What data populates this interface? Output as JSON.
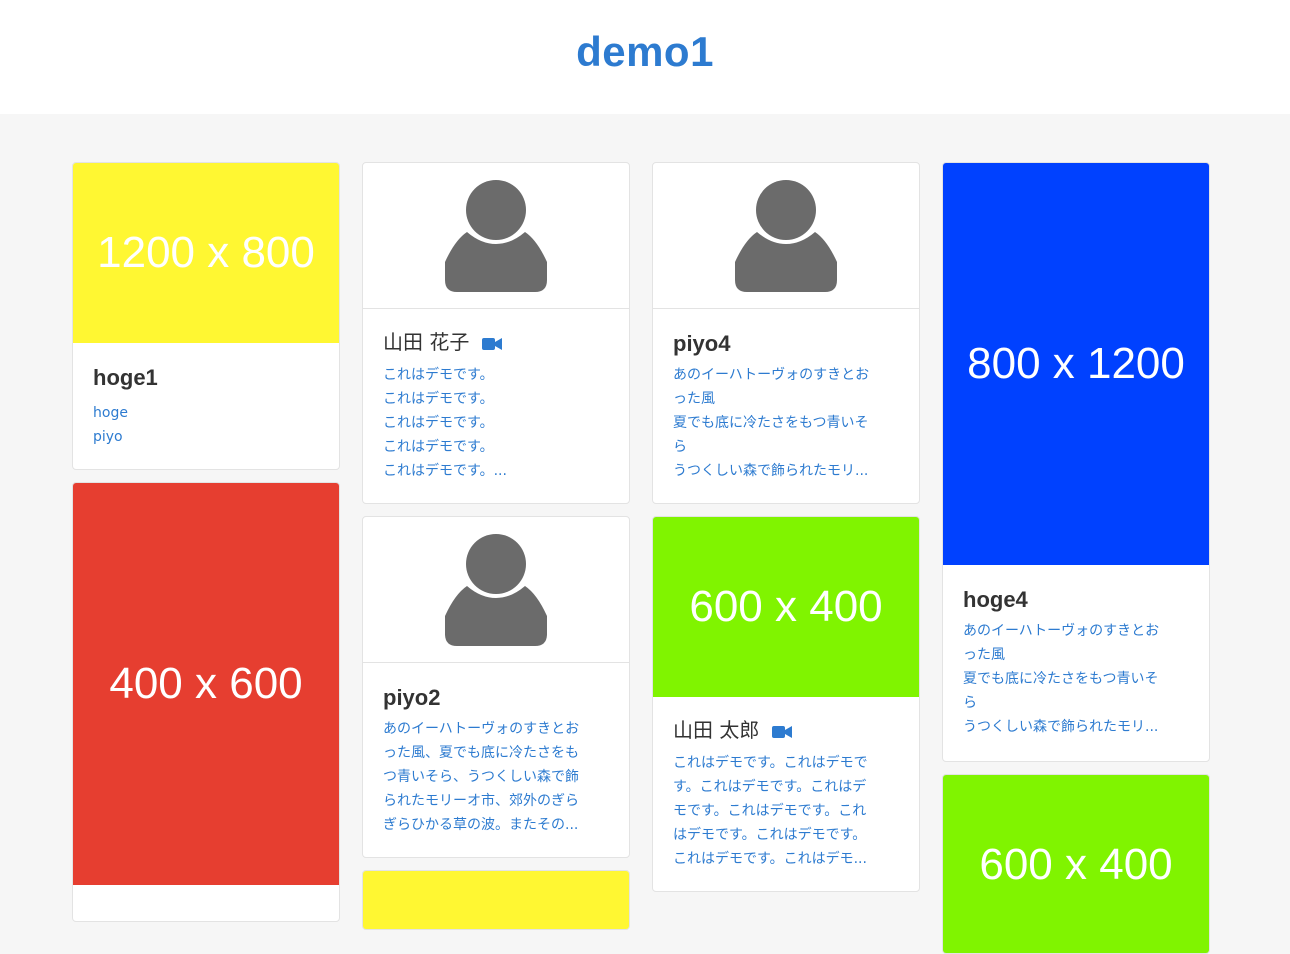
{
  "header": {
    "title": "demo1"
  },
  "cards": {
    "c1": {
      "image": "1200 x 800",
      "image_color": "#fff732",
      "title": "hoge1",
      "lines": [
        "hoge",
        "piyo"
      ]
    },
    "c2": {
      "image": "400 x 600",
      "image_color": "#e63e30"
    },
    "c3": {
      "avatar_icon": "user-icon",
      "title": "山田 花子",
      "has_video": true,
      "lines": [
        "これはデモです。",
        "これはデモです。",
        "これはデモです。",
        "これはデモです。",
        "これはデモです。..."
      ]
    },
    "c4": {
      "avatar_icon": "user-icon",
      "title": "piyo2",
      "lines": [
        "あのイーハトーヴォのすきとお",
        "った風、夏でも底に冷たさをも",
        "つ青いそら、うつくしい森で飾",
        "られたモリーオ市、郊外のぎら",
        "ぎらひかる草の波。またその..."
      ]
    },
    "c5": {
      "image_color": "#fff732"
    },
    "c6": {
      "avatar_icon": "user-icon",
      "title": "piyo4",
      "lines": [
        "あのイーハトーヴォのすきとお",
        "った風",
        "夏でも底に冷たさをもつ青いそ",
        "ら",
        "うつくしい森で飾られたモリ..."
      ]
    },
    "c7": {
      "image": "600 x 400",
      "image_color": "#80f400",
      "title": "山田 太郎",
      "has_video": true,
      "lines": [
        "これはデモです。これはデモで",
        "す。これはデモです。これはデ",
        "モです。これはデモです。これ",
        "はデモです。これはデモです。",
        "これはデモです。これはデモ..."
      ]
    },
    "c8": {
      "image": "800 x 1200",
      "image_color": "#0041ff",
      "title": "hoge4",
      "lines": [
        "あのイーハトーヴォのすきとお",
        "った風",
        "夏でも底に冷たさをもつ青いそ",
        "ら",
        "うつくしい森で飾られたモリ..."
      ]
    },
    "c9": {
      "image": "600 x 400",
      "image_color": "#80f400"
    }
  },
  "colors": {
    "accent": "#2d7bd0",
    "avatar": "#6b6b6b"
  }
}
